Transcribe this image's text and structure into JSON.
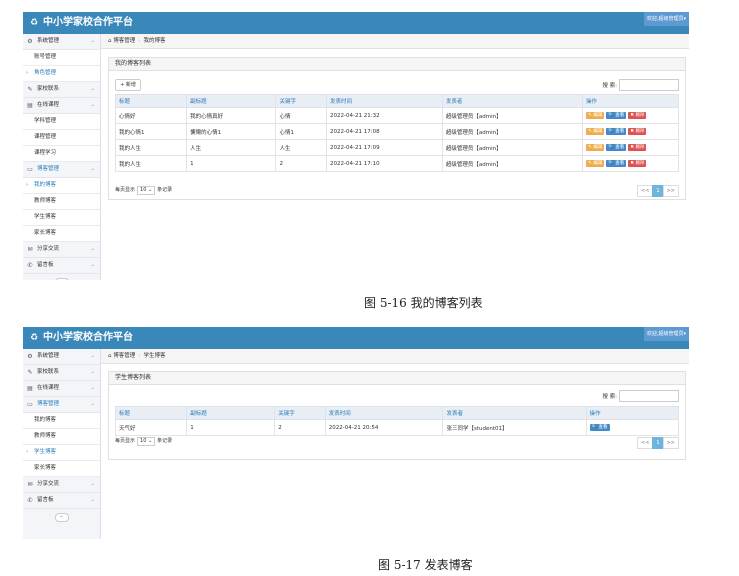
{
  "figure1": {
    "app_title": "中小学家校合作平台",
    "user_label": "欢迎,超级管理员▾",
    "sidebar": [
      {
        "label": "系统管理",
        "icon": "gears-icon",
        "chevron": "⌄",
        "children": [
          {
            "label": "账号管理"
          },
          {
            "label": "角色管理",
            "active": true
          }
        ]
      },
      {
        "label": "家校联系",
        "icon": "tags-icon",
        "chevron": "⌄",
        "children": []
      },
      {
        "label": "在线课程",
        "icon": "book-icon",
        "chevron": "⌄",
        "children": [
          {
            "label": "学科管理"
          },
          {
            "label": "课程管理"
          },
          {
            "label": "课程学习"
          }
        ]
      },
      {
        "label": "博客管理",
        "icon": "desktop-icon",
        "chevron": "⌄",
        "open": true,
        "children": [
          {
            "label": "我的博客",
            "active": true
          },
          {
            "label": "教师博客"
          },
          {
            "label": "学生博客"
          },
          {
            "label": "家长博客"
          }
        ]
      },
      {
        "label": "分享交流",
        "icon": "comments-icon",
        "chevron": "⌄",
        "children": []
      },
      {
        "label": "留言板",
        "icon": "comment-icon",
        "chevron": "⌄",
        "children": []
      }
    ],
    "breadcrumb": [
      "博客管理",
      "我的博客"
    ],
    "panel_title": "我的博客列表",
    "add_label": "+ 新增",
    "search_label": "搜 索:",
    "columns": [
      "标题",
      "副标题",
      "关键字",
      "发表时间",
      "发表者",
      "操作"
    ],
    "rows": [
      [
        "心情好",
        "我的心情真好",
        "心情",
        "2022-04-21 21:32",
        "超级管理员【admin】"
      ],
      [
        "我的心情1",
        "慵懒的心情1",
        "心情1",
        "2022-04-21 17:08",
        "超级管理员【admin】"
      ],
      [
        "我的人生",
        "人生",
        "人生",
        "2022-04-21 17:09",
        "超级管理员【admin】"
      ],
      [
        "我的人生",
        "1",
        "2",
        "2022-04-21 17:10",
        "超级管理员【admin】"
      ]
    ],
    "actions": [
      "✎ 编辑",
      "🔍 查看",
      "✖ 删除"
    ],
    "page_size_prefix": "每页显示",
    "page_size": "10 ⌄",
    "page_size_suffix": "条记录",
    "pager": [
      "<<",
      "1",
      ">>"
    ],
    "caption": "图 5-16 我的博客列表"
  },
  "figure2": {
    "app_title": "中小学家校合作平台",
    "user_label": "欢迎,超级管理员▾",
    "sidebar": [
      {
        "label": "系统管理",
        "icon": "gears-icon",
        "chevron": "⌄",
        "children": []
      },
      {
        "label": "家校联系",
        "icon": "tags-icon",
        "chevron": "⌄",
        "children": []
      },
      {
        "label": "在线课程",
        "icon": "book-icon",
        "chevron": "⌄",
        "children": []
      },
      {
        "label": "博客管理",
        "icon": "desktop-icon",
        "chevron": "⌄",
        "open": true,
        "children": [
          {
            "label": "我的博客"
          },
          {
            "label": "教师博客"
          },
          {
            "label": "学生博客",
            "active": true
          },
          {
            "label": "家长博客"
          }
        ]
      },
      {
        "label": "分享交流",
        "icon": "comments-icon",
        "chevron": "⌄",
        "children": []
      },
      {
        "label": "留言板",
        "icon": "comment-icon",
        "chevron": "⌄",
        "children": []
      }
    ],
    "breadcrumb": [
      "博客管理",
      "学生博客"
    ],
    "panel_title": "学生博客列表",
    "search_label": "搜 索:",
    "columns": [
      "标题",
      "副标题",
      "关键字",
      "发表时间",
      "发表者",
      "操作"
    ],
    "rows": [
      [
        "天气好",
        "1",
        "2",
        "2022-04-21 20:54",
        "张三同学【student01】"
      ]
    ],
    "actions": [
      "🔍 查看"
    ],
    "page_size_prefix": "每页显示",
    "page_size": "10 ⌄",
    "page_size_suffix": "条记录",
    "pager": [
      "<<",
      "1",
      ">>"
    ],
    "caption": "图 5-17 发表博客"
  },
  "colors": {
    "header": "#3a87b9",
    "accent": "#2b7dbc",
    "edit": "#f0ad4e",
    "view": "#428bca",
    "delete": "#d9534f"
  }
}
